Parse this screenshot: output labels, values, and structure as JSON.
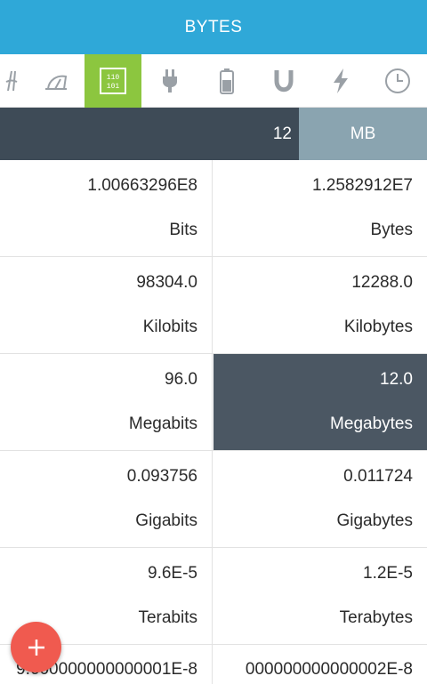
{
  "app": {
    "title": "BYTES"
  },
  "categories": [
    {
      "icon": "length-icon",
      "active": false
    },
    {
      "icon": "speed-gauge-icon",
      "active": false
    },
    {
      "icon": "binary-bytes-icon",
      "active": true,
      "glyph_top": "110",
      "glyph_bottom": "101"
    },
    {
      "icon": "plug-icon",
      "active": false
    },
    {
      "icon": "battery-icon",
      "active": false
    },
    {
      "icon": "magnet-icon",
      "active": false
    },
    {
      "icon": "lightning-icon",
      "active": false
    },
    {
      "icon": "clock-icon",
      "active": false
    }
  ],
  "input": {
    "value": "12",
    "unit": "MB"
  },
  "results": [
    {
      "left": {
        "value": "1.00663296E8",
        "unit": "Bits"
      },
      "right": {
        "value": "1.2582912E7",
        "unit": "Bytes"
      }
    },
    {
      "left": {
        "value": "98304.0",
        "unit": "Kilobits"
      },
      "right": {
        "value": "12288.0",
        "unit": "Kilobytes"
      }
    },
    {
      "left": {
        "value": "96.0",
        "unit": "Megabits"
      },
      "right": {
        "value": "12.0",
        "unit": "Megabytes",
        "selected": true
      }
    },
    {
      "left": {
        "value": "0.093756",
        "unit": "Gigabits"
      },
      "right": {
        "value": "0.011724",
        "unit": "Gigabytes"
      }
    },
    {
      "left": {
        "value": "9.6E-5",
        "unit": "Terabits"
      },
      "right": {
        "value": "1.2E-5",
        "unit": "Terabytes"
      }
    }
  ],
  "last_row": {
    "left_value": "9.600000000000001E-8",
    "right_value": "000000000000002E-8"
  },
  "colors": {
    "titlebar": "#2fa8d8",
    "active_tab": "#8cc63f",
    "input_bar": "#3e4b57",
    "unit_select": "#8aa4b0",
    "selected_cell": "#4b5763",
    "fab": "#f05a4f"
  }
}
